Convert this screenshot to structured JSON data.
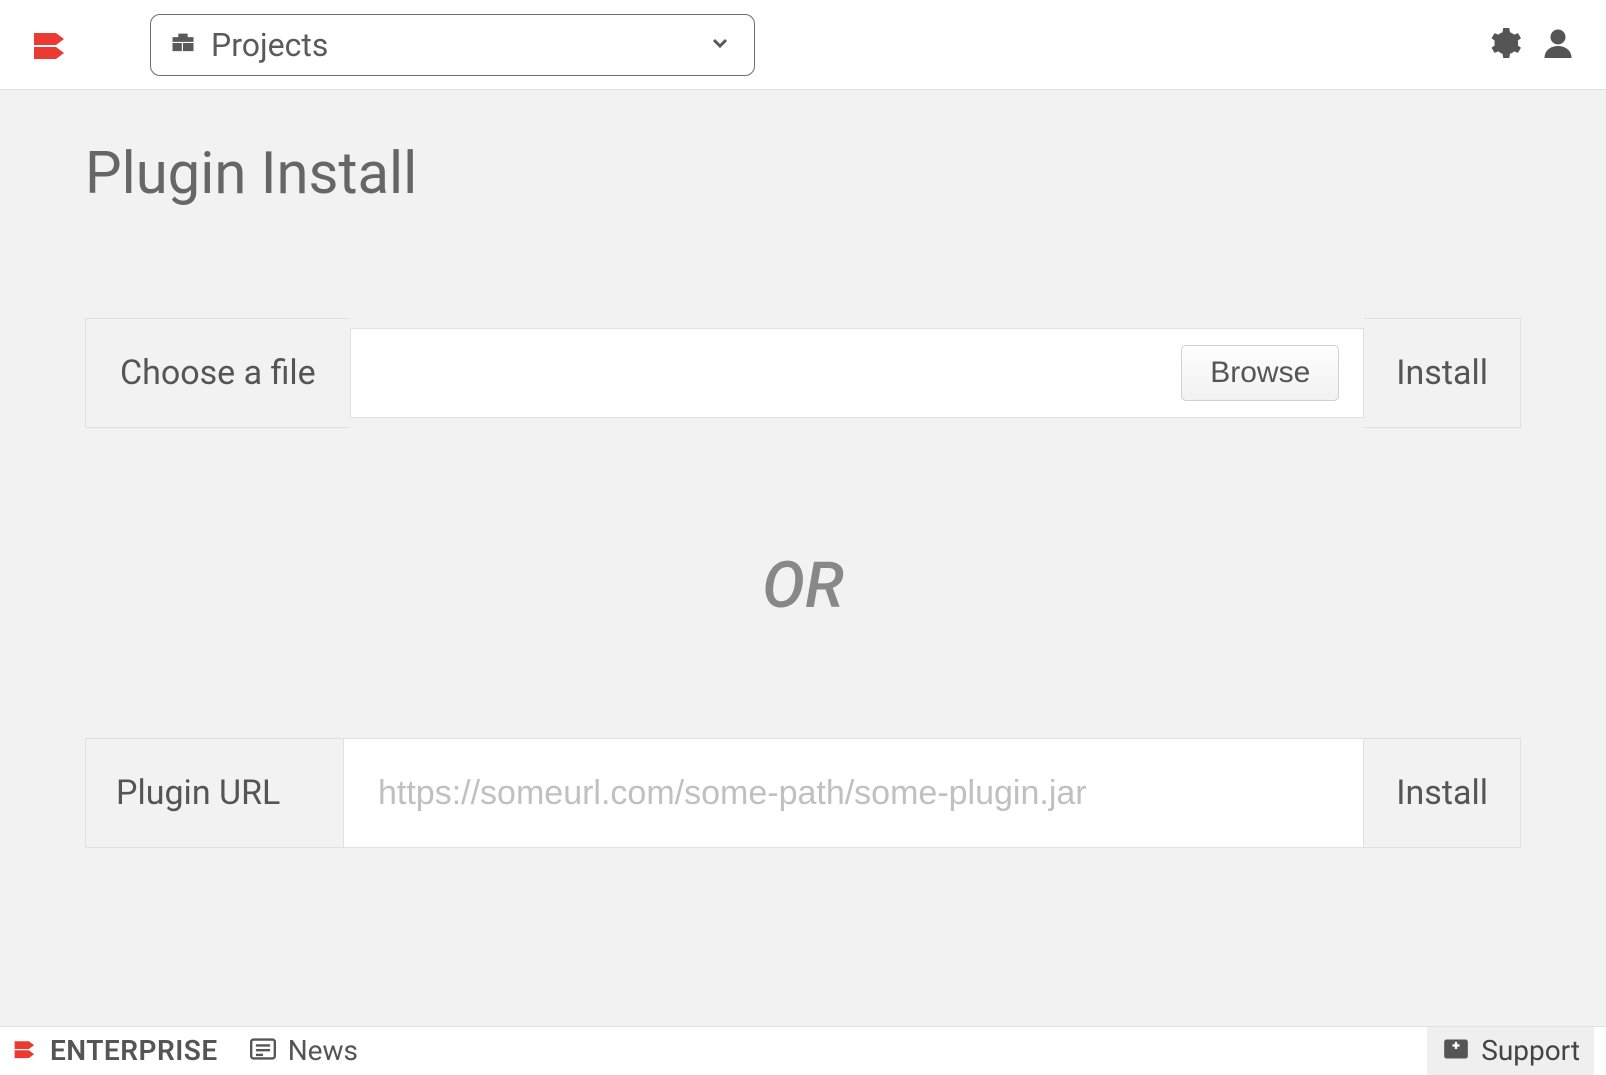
{
  "header": {
    "projects_label": "Projects"
  },
  "page": {
    "title": "Plugin Install",
    "file_label": "Choose a file",
    "browse_label": "Browse",
    "install_label": "Install",
    "or_text": "OR",
    "url_label": "Plugin URL",
    "url_placeholder": "https://someurl.com/some-path/some-plugin.jar"
  },
  "footer": {
    "enterprise": "ENTERPRISE",
    "news": "News",
    "support": "Support"
  },
  "colors": {
    "brand": "#eb3a32"
  }
}
